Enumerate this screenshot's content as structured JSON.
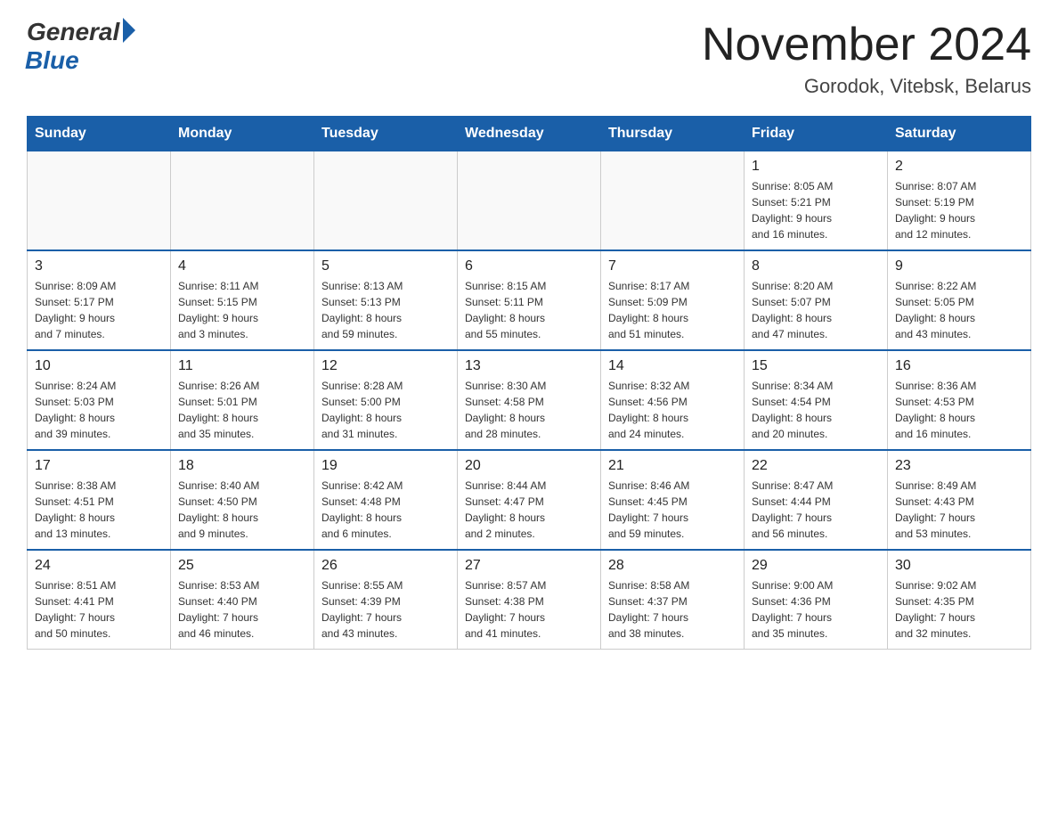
{
  "logo": {
    "general": "General",
    "blue": "Blue"
  },
  "title": "November 2024",
  "location": "Gorodok, Vitebsk, Belarus",
  "days_of_week": [
    "Sunday",
    "Monday",
    "Tuesday",
    "Wednesday",
    "Thursday",
    "Friday",
    "Saturday"
  ],
  "weeks": [
    [
      {
        "day": "",
        "info": ""
      },
      {
        "day": "",
        "info": ""
      },
      {
        "day": "",
        "info": ""
      },
      {
        "day": "",
        "info": ""
      },
      {
        "day": "",
        "info": ""
      },
      {
        "day": "1",
        "info": "Sunrise: 8:05 AM\nSunset: 5:21 PM\nDaylight: 9 hours\nand 16 minutes."
      },
      {
        "day": "2",
        "info": "Sunrise: 8:07 AM\nSunset: 5:19 PM\nDaylight: 9 hours\nand 12 minutes."
      }
    ],
    [
      {
        "day": "3",
        "info": "Sunrise: 8:09 AM\nSunset: 5:17 PM\nDaylight: 9 hours\nand 7 minutes."
      },
      {
        "day": "4",
        "info": "Sunrise: 8:11 AM\nSunset: 5:15 PM\nDaylight: 9 hours\nand 3 minutes."
      },
      {
        "day": "5",
        "info": "Sunrise: 8:13 AM\nSunset: 5:13 PM\nDaylight: 8 hours\nand 59 minutes."
      },
      {
        "day": "6",
        "info": "Sunrise: 8:15 AM\nSunset: 5:11 PM\nDaylight: 8 hours\nand 55 minutes."
      },
      {
        "day": "7",
        "info": "Sunrise: 8:17 AM\nSunset: 5:09 PM\nDaylight: 8 hours\nand 51 minutes."
      },
      {
        "day": "8",
        "info": "Sunrise: 8:20 AM\nSunset: 5:07 PM\nDaylight: 8 hours\nand 47 minutes."
      },
      {
        "day": "9",
        "info": "Sunrise: 8:22 AM\nSunset: 5:05 PM\nDaylight: 8 hours\nand 43 minutes."
      }
    ],
    [
      {
        "day": "10",
        "info": "Sunrise: 8:24 AM\nSunset: 5:03 PM\nDaylight: 8 hours\nand 39 minutes."
      },
      {
        "day": "11",
        "info": "Sunrise: 8:26 AM\nSunset: 5:01 PM\nDaylight: 8 hours\nand 35 minutes."
      },
      {
        "day": "12",
        "info": "Sunrise: 8:28 AM\nSunset: 5:00 PM\nDaylight: 8 hours\nand 31 minutes."
      },
      {
        "day": "13",
        "info": "Sunrise: 8:30 AM\nSunset: 4:58 PM\nDaylight: 8 hours\nand 28 minutes."
      },
      {
        "day": "14",
        "info": "Sunrise: 8:32 AM\nSunset: 4:56 PM\nDaylight: 8 hours\nand 24 minutes."
      },
      {
        "day": "15",
        "info": "Sunrise: 8:34 AM\nSunset: 4:54 PM\nDaylight: 8 hours\nand 20 minutes."
      },
      {
        "day": "16",
        "info": "Sunrise: 8:36 AM\nSunset: 4:53 PM\nDaylight: 8 hours\nand 16 minutes."
      }
    ],
    [
      {
        "day": "17",
        "info": "Sunrise: 8:38 AM\nSunset: 4:51 PM\nDaylight: 8 hours\nand 13 minutes."
      },
      {
        "day": "18",
        "info": "Sunrise: 8:40 AM\nSunset: 4:50 PM\nDaylight: 8 hours\nand 9 minutes."
      },
      {
        "day": "19",
        "info": "Sunrise: 8:42 AM\nSunset: 4:48 PM\nDaylight: 8 hours\nand 6 minutes."
      },
      {
        "day": "20",
        "info": "Sunrise: 8:44 AM\nSunset: 4:47 PM\nDaylight: 8 hours\nand 2 minutes."
      },
      {
        "day": "21",
        "info": "Sunrise: 8:46 AM\nSunset: 4:45 PM\nDaylight: 7 hours\nand 59 minutes."
      },
      {
        "day": "22",
        "info": "Sunrise: 8:47 AM\nSunset: 4:44 PM\nDaylight: 7 hours\nand 56 minutes."
      },
      {
        "day": "23",
        "info": "Sunrise: 8:49 AM\nSunset: 4:43 PM\nDaylight: 7 hours\nand 53 minutes."
      }
    ],
    [
      {
        "day": "24",
        "info": "Sunrise: 8:51 AM\nSunset: 4:41 PM\nDaylight: 7 hours\nand 50 minutes."
      },
      {
        "day": "25",
        "info": "Sunrise: 8:53 AM\nSunset: 4:40 PM\nDaylight: 7 hours\nand 46 minutes."
      },
      {
        "day": "26",
        "info": "Sunrise: 8:55 AM\nSunset: 4:39 PM\nDaylight: 7 hours\nand 43 minutes."
      },
      {
        "day": "27",
        "info": "Sunrise: 8:57 AM\nSunset: 4:38 PM\nDaylight: 7 hours\nand 41 minutes."
      },
      {
        "day": "28",
        "info": "Sunrise: 8:58 AM\nSunset: 4:37 PM\nDaylight: 7 hours\nand 38 minutes."
      },
      {
        "day": "29",
        "info": "Sunrise: 9:00 AM\nSunset: 4:36 PM\nDaylight: 7 hours\nand 35 minutes."
      },
      {
        "day": "30",
        "info": "Sunrise: 9:02 AM\nSunset: 4:35 PM\nDaylight: 7 hours\nand 32 minutes."
      }
    ]
  ]
}
